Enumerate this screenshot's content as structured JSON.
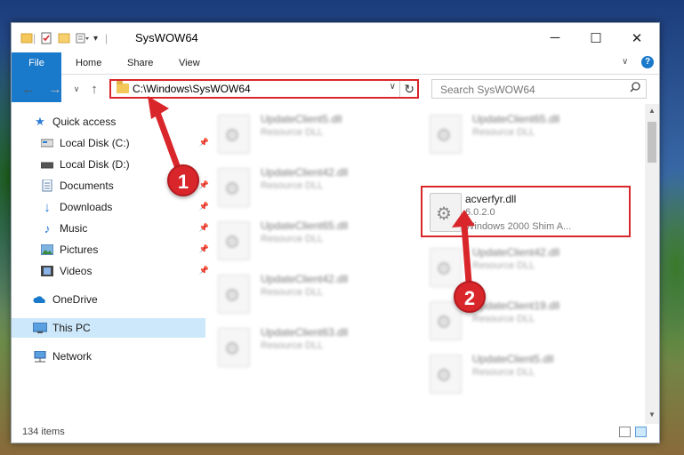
{
  "window": {
    "title": "SysWOW64",
    "minimize": "─",
    "maximize": "☐",
    "close": "✕"
  },
  "ribbon": {
    "tabs": [
      "File",
      "Home",
      "Share",
      "View"
    ],
    "expand": "∨",
    "help": "?"
  },
  "nav": {
    "back": "←",
    "forward": "→",
    "recent": "∨",
    "up": "↑"
  },
  "address": {
    "path": "C:\\Windows\\SysWOW64",
    "dropdown": "∨",
    "refresh": "↻"
  },
  "search": {
    "placeholder": "Search SysWOW64",
    "icon": "search-icon"
  },
  "sidebar": {
    "items": [
      {
        "label": "Quick access",
        "icon": "star-icon",
        "pinned": false
      },
      {
        "label": "Local Disk (C:)",
        "icon": "drive-icon",
        "pinned": true
      },
      {
        "label": "Local Disk (D:)",
        "icon": "drive-icon",
        "pinned": false
      },
      {
        "label": "Documents",
        "icon": "documents-icon",
        "pinned": true
      },
      {
        "label": "Downloads",
        "icon": "downloads-icon",
        "pinned": true
      },
      {
        "label": "Music",
        "icon": "music-icon",
        "pinned": true
      },
      {
        "label": "Pictures",
        "icon": "pictures-icon",
        "pinned": true
      },
      {
        "label": "Videos",
        "icon": "videos-icon",
        "pinned": true
      },
      {
        "label": "OneDrive",
        "icon": "cloud-icon",
        "pinned": false
      },
      {
        "label": "This PC",
        "icon": "computer-icon",
        "pinned": false,
        "selected": true
      },
      {
        "label": "Network",
        "icon": "network-icon",
        "pinned": false
      }
    ]
  },
  "files": [
    {
      "name": "UpdateClient5.dll",
      "desc": "Resource DLL"
    },
    {
      "name": "UpdateClient65.dll",
      "desc": "Resource DLL"
    },
    {
      "name": "UpdateClient42.dll",
      "desc": "Resource DLL"
    },
    {
      "name": "acverfyr.dll",
      "version": "6.0.2.0",
      "desc": "Windows 2000 Shim A...",
      "highlighted": true
    },
    {
      "name": "UpdateClient65.dll",
      "desc": "Resource DLL"
    },
    {
      "name": "UpdateClient42.dll",
      "desc": "Resource DLL"
    },
    {
      "name": "UpdateClient42.dll",
      "desc": "Resource DLL"
    },
    {
      "name": "UpdateClient19.dll",
      "desc": "Resource DLL"
    },
    {
      "name": "UpdateClient63.dll",
      "desc": "Resource DLL"
    },
    {
      "name": "UpdateClient5.dll",
      "desc": "Resource DLL"
    }
  ],
  "status": {
    "count": "134 items"
  },
  "annotations": {
    "step1": "1",
    "step2": "2",
    "color": "#d9262b"
  },
  "colors": {
    "accent": "#1979ca",
    "selection": "#cde8fa",
    "highlight": "#d9262b"
  }
}
